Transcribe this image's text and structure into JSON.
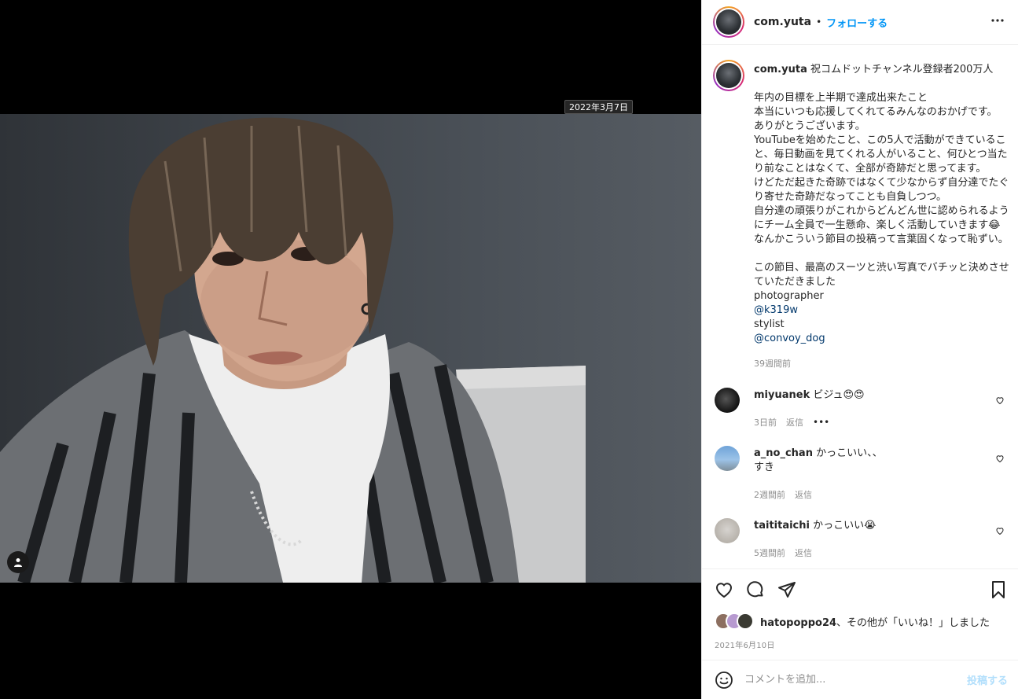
{
  "media": {
    "date_tag": "2022年3月7日",
    "photo_alt": "user-tag"
  },
  "header": {
    "username": "com.yuta",
    "separator": "•",
    "follow_label": "フォローする"
  },
  "caption": {
    "username": "com.yuta",
    "lines": [
      " 祝コムドットチャンネル登録者200万人",
      "",
      "年内の目標を上半期で達成出来たこと",
      "本当にいつも応援してくれてるみんなのおかげです。",
      "ありがとうございます。",
      "YouTubeを始めたこと、この5人で活動ができていること、毎日動画を見てくれる人がいること、何ひとつ当たり前なことはなくて、全部が奇跡だと思ってます。",
      "けどただ起きた奇跡ではなくて少なからず自分達でたぐり寄せた奇跡だなってことも自負しつつ。",
      "自分達の頑張りがこれからどんどん世に認められるようにチーム全員で一生懸命、楽しく活動していきます😂",
      "なんかこういう節目の投稿って言葉固くなって恥ずい。",
      "",
      "この節目、最高のスーツと渋い写真でバチッと決めさせていただきました",
      "photographer"
    ],
    "mention1": "@k319w",
    "label2": "stylist",
    "mention2": "@convoy_dog",
    "time_ago": "39週間前"
  },
  "comments": [
    {
      "username": "miyuanek",
      "text": " ビジュ😍😍",
      "time": "3日前",
      "reply": "返信",
      "more": "•••"
    },
    {
      "username": "a_no_chan",
      "text": " かっこいい、、\nすき",
      "time": "2週間前",
      "reply": "返信"
    },
    {
      "username": "taititaichi",
      "text": " かっこいい😭",
      "time": "5週間前",
      "reply": "返信"
    }
  ],
  "likes": {
    "user": "hatopoppo24",
    "rest": "、その他が「いいね！」しました"
  },
  "post_date": "2021年6月10日",
  "add_comment": {
    "placeholder": "コメントを追加...",
    "post_label": "投稿する"
  },
  "icons": [
    "heart-icon",
    "comment-icon",
    "share-icon",
    "bookmark-icon",
    "emoji-icon",
    "more-icon",
    "user-tag-icon"
  ]
}
